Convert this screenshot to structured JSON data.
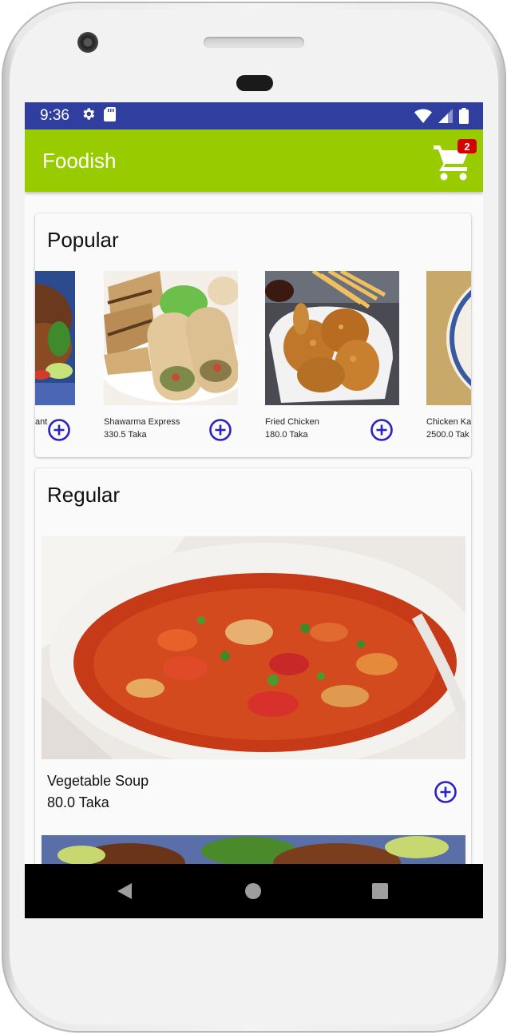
{
  "status_bar": {
    "time": "9:36",
    "icons_left": [
      "gear-icon",
      "sd-card-icon"
    ],
    "icons_right": [
      "wifi-icon",
      "cellular-signal-icon",
      "battery-icon"
    ]
  },
  "app_bar": {
    "title": "Foodish",
    "cart_badge": "2",
    "color": "#99cc00"
  },
  "popular": {
    "title": "Popular",
    "items": [
      {
        "name": "ant",
        "price": ""
      },
      {
        "name": "Shawarma Express",
        "price": "330.5 Taka"
      },
      {
        "name": "Fried Chicken",
        "price": "180.0 Taka"
      },
      {
        "name": "Chicken Ka",
        "price": "2500.0 Tak"
      }
    ]
  },
  "regular": {
    "title": "Regular",
    "items": [
      {
        "name": "Vegetable Soup",
        "price": "80.0 Taka"
      }
    ]
  },
  "colors": {
    "status_bar": "#303f9f",
    "accent": "#2b22c4"
  }
}
